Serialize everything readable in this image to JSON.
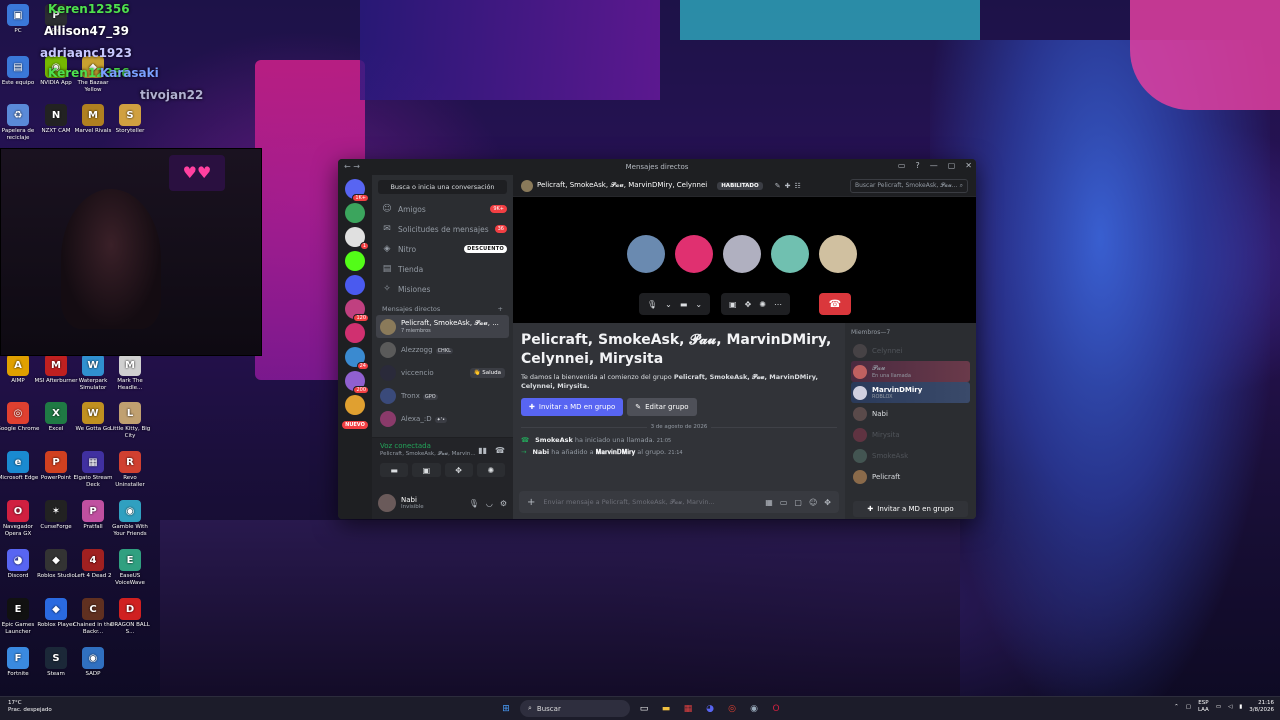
{
  "desktop": {
    "icons": [
      {
        "label": "PC",
        "glyph": "▣",
        "color": "#3a78d8"
      },
      {
        "label": "Pro",
        "glyph": "P",
        "color": "#2b2d31"
      },
      {
        "label": "Este equipo",
        "glyph": "▤",
        "color": "#3a78d8"
      },
      {
        "label": "NVIDIA App",
        "glyph": "◉",
        "color": "#76b900"
      },
      {
        "label": "The Bazaar Yellow",
        "glyph": "◆",
        "color": "#c8a030"
      },
      {
        "label": "Papelera de reciclaje",
        "glyph": "♻",
        "color": "#5a8ad8"
      },
      {
        "label": "NZXT CAM",
        "glyph": "N",
        "color": "#222"
      },
      {
        "label": "Marvel Rivals",
        "glyph": "M",
        "color": "#b08020"
      },
      {
        "label": "Storyteller",
        "glyph": "S",
        "color": "#d0a040"
      },
      {
        "label": "AIMP",
        "glyph": "A",
        "color": "#e0a000"
      },
      {
        "label": "MSI Afterburner",
        "glyph": "M",
        "color": "#c02020"
      },
      {
        "label": "Waterpark Simulator",
        "glyph": "W",
        "color": "#3090d0"
      },
      {
        "label": "Mark The Headle...",
        "glyph": "M",
        "color": "#d0d0d0"
      },
      {
        "label": "Google Chrome",
        "glyph": "◎",
        "color": "#e04030"
      },
      {
        "label": "Excel",
        "glyph": "X",
        "color": "#1f7a44"
      },
      {
        "label": "We Gotta Go",
        "glyph": "W",
        "color": "#c09020"
      },
      {
        "label": "Little Kitty, Big City",
        "glyph": "L",
        "color": "#c0a070"
      },
      {
        "label": "Microsoft Edge",
        "glyph": "e",
        "color": "#1a8ad0"
      },
      {
        "label": "PowerPoint",
        "glyph": "P",
        "color": "#d04020"
      },
      {
        "label": "Elgato Stream Deck",
        "glyph": "▦",
        "color": "#4030a0"
      },
      {
        "label": "Revo Uninstaller",
        "glyph": "R",
        "color": "#d04030"
      },
      {
        "label": "Navegador Opera GX",
        "glyph": "O",
        "color": "#d02040"
      },
      {
        "label": "CurseForge",
        "glyph": "✶",
        "color": "#222"
      },
      {
        "label": "Pratfall",
        "glyph": "P",
        "color": "#c050a0"
      },
      {
        "label": "Gamble With Your Friends",
        "glyph": "◉",
        "color": "#30a0c0"
      },
      {
        "label": "Discord",
        "glyph": "◕",
        "color": "#5865f2"
      },
      {
        "label": "Roblox Studio",
        "glyph": "◆",
        "color": "#333"
      },
      {
        "label": "Left 4 Dead 2",
        "glyph": "4",
        "color": "#a02020"
      },
      {
        "label": "EaseUS VoiceWave",
        "glyph": "E",
        "color": "#30a080"
      },
      {
        "label": "Epic Games Launcher",
        "glyph": "E",
        "color": "#111"
      },
      {
        "label": "Roblox Player",
        "glyph": "◆",
        "color": "#2a6ae0"
      },
      {
        "label": "Chained in the Backr...",
        "glyph": "C",
        "color": "#603020"
      },
      {
        "label": "DRAGON BALL S...",
        "glyph": "D",
        "color": "#d02020"
      },
      {
        "label": "Fortnite",
        "glyph": "F",
        "color": "#3a8ae0"
      },
      {
        "label": "Steam",
        "glyph": "S",
        "color": "#1b2838"
      },
      {
        "label": "SADP",
        "glyph": "◉",
        "color": "#3070c0"
      }
    ],
    "overlays": [
      {
        "text": "Keren12356",
        "color": "#4ee04e"
      },
      {
        "text": "Allison47_39",
        "color": "#ffffff"
      },
      {
        "text": "adriaanc1923",
        "color": "#c8c8ff"
      },
      {
        "text": "Keren12356",
        "color": "#4ee04e"
      },
      {
        "text": "Karasaki",
        "color": "#7aa0ff"
      },
      {
        "text": "tivojan22",
        "color": "#b0b0d0"
      }
    ]
  },
  "window": {
    "title": "Mensajes directos",
    "controls": [
      "▭",
      "?",
      "—",
      "▢",
      "✕"
    ]
  },
  "guilds": [
    {
      "color": "#5865f2",
      "badge": "1K+"
    },
    {
      "color": "#3ba55d",
      "badge": ""
    },
    {
      "color": "#e0e0e0",
      "badge": "1"
    },
    {
      "color": "#53fc18",
      "badge": ""
    },
    {
      "color": "#4a5aef",
      "badge": ""
    },
    {
      "color": "#c04080",
      "badge": "120"
    },
    {
      "color": "#d03070",
      "badge": ""
    },
    {
      "color": "#3a8ad0",
      "badge": "24"
    },
    {
      "color": "#9060d0",
      "badge": "200"
    },
    {
      "color": "#e0a030",
      "badge": ""
    }
  ],
  "guild_new_label": "NUEVO",
  "sidebar": {
    "search_placeholder": "Busca o inicia una conversación",
    "nav": [
      {
        "label": "Amigos",
        "icon": "☺",
        "badge": "9K+",
        "badge_type": "red"
      },
      {
        "label": "Solicitudes de mensajes",
        "icon": "✉",
        "badge": "36",
        "badge_type": "red"
      },
      {
        "label": "Nitro",
        "icon": "◈",
        "badge": "DESCUENTO",
        "badge_type": "white"
      },
      {
        "label": "Tienda",
        "icon": "▤",
        "badge": "",
        "badge_type": ""
      },
      {
        "label": "Misiones",
        "icon": "✧",
        "badge": "",
        "badge_type": ""
      }
    ],
    "dm_header": "Mensajes directos",
    "dm_add": "+",
    "dms": [
      {
        "name": "Pelicraft, SmokeAsk, 𝓟𝓪𝓾, ...",
        "sub": "7 miembros",
        "tag": "",
        "action": "",
        "active": true,
        "color": "#8a7a5a"
      },
      {
        "name": "Alezzogg",
        "sub": "",
        "tag": "CHKL",
        "action": "",
        "active": false,
        "color": "#5a5a5a"
      },
      {
        "name": "viccencio",
        "sub": "",
        "tag": "",
        "action": "👋 Saluda",
        "active": false,
        "color": "#2a2a3a"
      },
      {
        "name": "Tronx",
        "sub": "",
        "tag": "GPO",
        "action": "",
        "active": false,
        "color": "#3a4a7a"
      },
      {
        "name": "Alexa_:D",
        "sub": "",
        "tag": "✦'•",
        "action": "",
        "active": false,
        "color": "#8a3a6a"
      }
    ],
    "voice": {
      "status": "Voz conectada",
      "channel": "Pelicraft, SmokeAsk, 𝓟𝓪𝓾, Marvin..."
    },
    "user": {
      "name": "Nabi",
      "status": "Invisible"
    }
  },
  "header": {
    "title": "Pelicraft, SmokeAsk, 𝓟𝓪𝓾, MarvinDMiry, Celynnei",
    "badge": "HABILITADO",
    "search_placeholder": "Buscar Pelicraft, SmokeAsk, 𝓟𝓪𝓾..."
  },
  "call": {
    "avatars": [
      {
        "color": "#6a8ab0"
      },
      {
        "color": "#e03070"
      },
      {
        "color": "#b0b0c0"
      },
      {
        "color": "#70c0b0"
      },
      {
        "color": "#d0c0a0"
      }
    ]
  },
  "chat": {
    "group_title": "Pelicraft, SmokeAsk, 𝓟𝓪𝓾, MarvinDMiry, Celynnei, Mirysita",
    "welcome_prefix": "Te damos la bienvenida al comienzo del grupo ",
    "welcome_names": "Pelicraft, SmokeAsk, 𝓟𝓪𝓾, MarvinDMiry, Celynnei, Mirysita.",
    "invite_button": "Invitar a MD en grupo",
    "edit_button": "Editar grupo",
    "date_divider": "3 de agosto de 2026",
    "events": [
      {
        "actor": "SmokeAsk",
        "text": " ha iniciado una llamada.",
        "extra": "",
        "time": "21:05"
      },
      {
        "actor": "Nabi",
        "text": " ha añadido a ",
        "extra": "𝐌𝐚𝐫𝐯𝐢𝐧𝐃𝐌𝐢𝐫𝐲",
        "suffix": " al grupo.",
        "time": "21:14"
      }
    ],
    "input_placeholder": "Enviar mensaje a Pelicraft, SmokeAsk, 𝓟𝓪𝓾, Marvin..."
  },
  "members": {
    "header": "Miembros—7",
    "list": [
      {
        "name": "Celynnei",
        "sub": "",
        "state": "dim",
        "color": "#7a6a6a"
      },
      {
        "name": "𝓟𝓪𝓾",
        "sub": "En una llamada",
        "state": "hl",
        "color": "#c06060"
      },
      {
        "name": "MarvinDMiry",
        "sub": "ROBLOX",
        "state": "hl2",
        "color": "#d0d0e0"
      },
      {
        "name": "Nabi",
        "sub": "",
        "state": "on-grey",
        "color": "#5a4a4a"
      },
      {
        "name": "Mirysita",
        "sub": "",
        "state": "dim",
        "color": "#c04060"
      },
      {
        "name": "SmokeAsk",
        "sub": "",
        "state": "dim",
        "color": "#70a090"
      },
      {
        "name": "Pelicraft",
        "sub": "",
        "state": "on",
        "color": "#8a6a4a"
      }
    ],
    "invite_button": "Invitar a MD en grupo"
  },
  "taskbar": {
    "weather_temp": "17°C",
    "weather_desc": "Prac. despejado",
    "search_label": "Buscar",
    "lang": "ESP",
    "lang2": "LAA",
    "time": "21:16",
    "date": "3/8/2026"
  }
}
